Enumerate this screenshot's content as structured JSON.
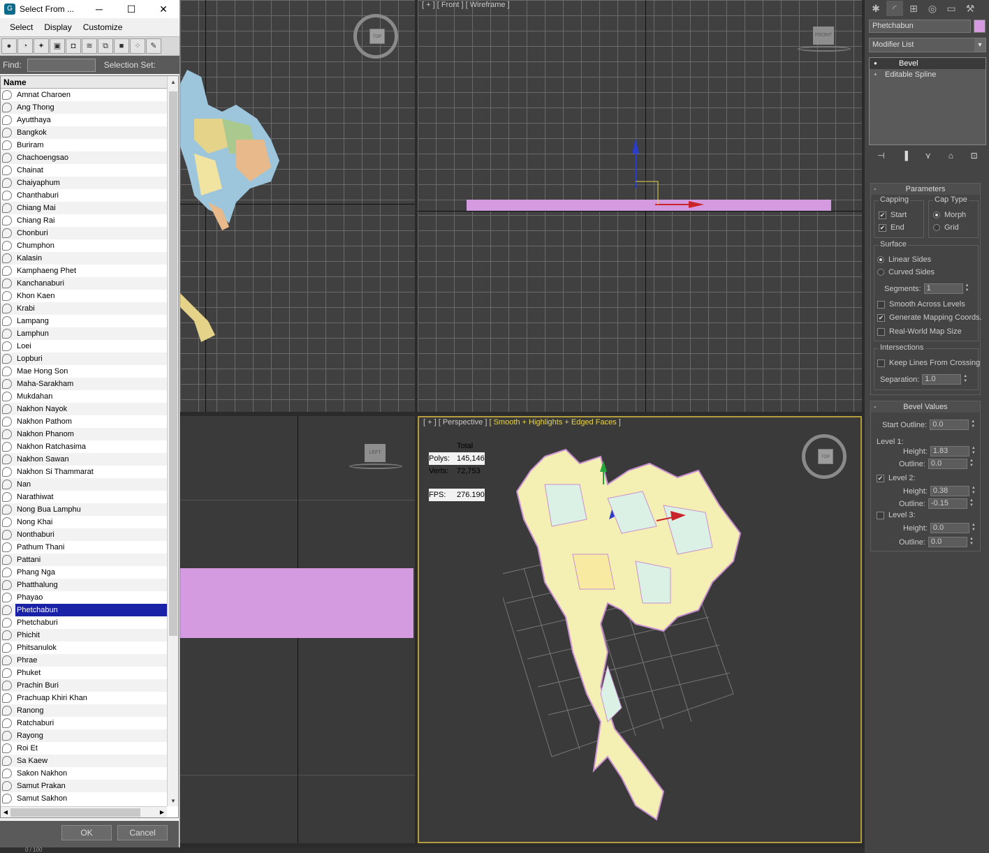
{
  "dialog": {
    "title": "Select From ...",
    "window_controls": {
      "minimize": "─",
      "maximize": "☐",
      "close": "✕"
    },
    "menu": [
      "Select",
      "Display",
      "Customize"
    ],
    "toolbar_icons": [
      "geometry-icon",
      "shapes-icon",
      "lights-icon",
      "cameras-icon",
      "helpers-icon",
      "spacewarps-icon",
      "groups-icon",
      "xrefs-icon",
      "bones-icon",
      "all-icon"
    ],
    "find_label": "Find:",
    "find_value": "",
    "selection_set_label": "Selection Set:",
    "column_header": "Name",
    "items": [
      "Amnat Charoen",
      "Ang Thong",
      "Ayutthaya",
      "Bangkok",
      "Buriram",
      "Chachoengsao",
      "Chainat",
      "Chaiyaphum",
      "Chanthaburi",
      "Chiang Mai",
      "Chiang Rai",
      "Chonburi",
      "Chumphon",
      "Kalasin",
      "Kamphaeng Phet",
      "Kanchanaburi",
      "Khon Kaen",
      "Krabi",
      "Lampang",
      "Lamphun",
      "Loei",
      "Lopburi",
      "Mae Hong Son",
      "Maha-Sarakham",
      "Mukdahan",
      "Nakhon Nayok",
      "Nakhon Pathom",
      "Nakhon Phanom",
      "Nakhon Ratchasima",
      "Nakhon Sawan",
      "Nakhon Si Thammarat",
      "Nan",
      "Narathiwat",
      "Nong Bua Lamphu",
      "Nong Khai",
      "Nonthaburi",
      "Pathum Thani",
      "Pattani",
      "Phang Nga",
      "Phatthalung",
      "Phayao",
      "Phetchabun",
      "Phetchaburi",
      "Phichit",
      "Phitsanulok",
      "Phrae",
      "Phuket",
      "Prachin Buri",
      "Prachuap Khiri Khan",
      "Ranong",
      "Ratchaburi",
      "Rayong",
      "Roi Et",
      "Sa Kaew",
      "Sakon Nakhon",
      "Samut Prakan",
      "Samut Sakhon"
    ],
    "selected_item": "Phetchabun",
    "ok_label": "OK",
    "cancel_label": "Cancel"
  },
  "viewports": {
    "top": {
      "viewcube": "TOP"
    },
    "front": {
      "label": "[ + ] [ Front ] [ Wireframe ]",
      "viewcube": "FRONT",
      "gizmo_x": "x",
      "gizmo_z": "z"
    },
    "left": {
      "viewcube": "LEFT"
    },
    "perspective": {
      "label_prefix": "[ + ] [ Perspective ]",
      "label_shading": "[ Smooth + Highlights + Edged Faces ]",
      "viewcube": "TOP",
      "stats": {
        "header": "Total",
        "polys_label": "Polys:",
        "polys": "145,146",
        "verts_label": "Verts:",
        "verts": "72,753",
        "fps_label": "FPS:",
        "fps": "276.190"
      }
    }
  },
  "command_panel": {
    "tabs": [
      "create-icon",
      "modify-icon",
      "hierarchy-icon",
      "motion-icon",
      "display-icon",
      "utilities-icon"
    ],
    "object_name": "Phetchabun",
    "object_color": "#d59be0",
    "modifier_list": "Modifier List",
    "stack": [
      {
        "label": "Bevel",
        "active": true
      },
      {
        "label": "Editable Spline",
        "active": false
      }
    ],
    "parameters": {
      "title": "Parameters",
      "capping_label": "Capping",
      "cap_start": "Start",
      "cap_end": "End",
      "cap_type_label": "Cap Type",
      "cap_morph": "Morph",
      "cap_grid": "Grid",
      "surface_label": "Surface",
      "linear_sides": "Linear Sides",
      "curved_sides": "Curved Sides",
      "segments_label": "Segments:",
      "segments": "1",
      "smooth_across": "Smooth Across Levels",
      "gen_mapping": "Generate Mapping Coords.",
      "real_world": "Real-World Map Size",
      "intersections_label": "Intersections",
      "keep_lines": "Keep Lines From Crossing",
      "separation_label": "Separation:",
      "separation": "1.0"
    },
    "bevel_values": {
      "title": "Bevel Values",
      "start_outline_label": "Start Outline:",
      "start_outline": "0.0",
      "level1_label": "Level 1:",
      "level1_height": "1.83",
      "level1_outline": "0.0",
      "level2_label": "Level 2:",
      "level2_height": "0.38",
      "level2_outline": "-0.15",
      "level3_label": "Level 3:",
      "level3_height": "0.0",
      "level3_outline": "0.0",
      "height_label": "Height:",
      "outline_label": "Outline:"
    }
  },
  "timeline": {
    "frame": "0 / 100"
  }
}
